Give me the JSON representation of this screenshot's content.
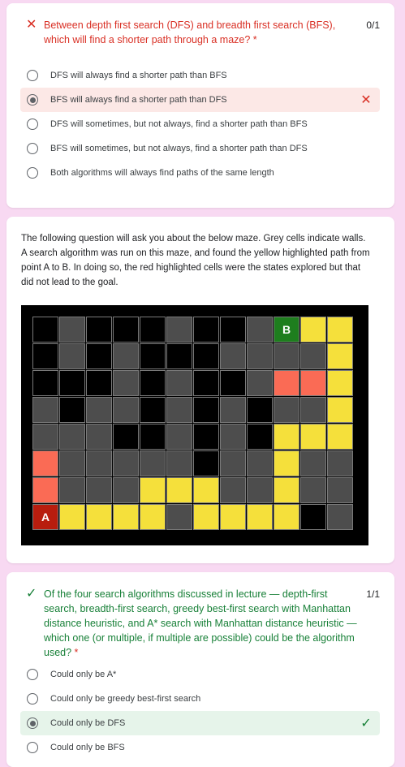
{
  "q1": {
    "mark": "✕",
    "text": "Between depth first search (DFS) and breadth first search (BFS), which will find a shorter path through a maze?",
    "required": " *",
    "score": "0/1",
    "options": [
      {
        "label": "DFS will always find a shorter path than BFS"
      },
      {
        "label": "BFS will always find a shorter path than DFS",
        "icon": "✕"
      },
      {
        "label": "DFS will sometimes, but not always, find a shorter path than BFS"
      },
      {
        "label": "BFS will sometimes, but not always, find a shorter path than DFS"
      },
      {
        "label": "Both algorithms will always find paths of the same length"
      }
    ],
    "selected_index": 1,
    "selected_icon_name": "x-mark-icon"
  },
  "maze_section": {
    "description": "The following question will ask you about the below maze. Grey cells indicate walls. A search algorithm was run on this maze, and found the yellow highlighted path from point A to B. In doing so, the red highlighted cells were the states explored but that did not lead to the goal.",
    "colors": {
      "K": "#000000",
      "G": "#4d4d4d",
      "Y": "#f5e03b",
      "R": "#fa6b55",
      "A": "#b81d0e",
      "B": "#1e7e1e"
    },
    "grid": [
      [
        "K",
        "G",
        "K",
        "K",
        "K",
        "G",
        "K",
        "K",
        "G",
        "B",
        "Y",
        "Y"
      ],
      [
        "K",
        "G",
        "K",
        "G",
        "K",
        "K",
        "K",
        "G",
        "G",
        "G",
        "G",
        "Y"
      ],
      [
        "K",
        "K",
        "K",
        "G",
        "K",
        "G",
        "K",
        "K",
        "G",
        "R",
        "R",
        "Y"
      ],
      [
        "G",
        "K",
        "G",
        "G",
        "K",
        "G",
        "K",
        "G",
        "K",
        "G",
        "G",
        "Y"
      ],
      [
        "G",
        "G",
        "G",
        "K",
        "K",
        "G",
        "K",
        "G",
        "K",
        "Y",
        "Y",
        "Y"
      ],
      [
        "R",
        "G",
        "G",
        "G",
        "G",
        "G",
        "K",
        "G",
        "G",
        "Y",
        "G",
        "G"
      ],
      [
        "R",
        "G",
        "G",
        "G",
        "Y",
        "Y",
        "Y",
        "G",
        "G",
        "Y",
        "G",
        "G"
      ],
      [
        "A",
        "Y",
        "Y",
        "Y",
        "Y",
        "G",
        "Y",
        "Y",
        "Y",
        "Y",
        "K",
        "G"
      ]
    ],
    "label_A": "A",
    "label_B": "B"
  },
  "q2": {
    "mark": "✓",
    "text": "Of the four search algorithms discussed in lecture — depth-first search, breadth-first search, greedy best-first search with Manhattan distance heuristic, and A* search with Manhattan distance heuristic — which one (or multiple, if multiple are possible) could be the algorithm used?",
    "required": " *",
    "score": "1/1",
    "options": [
      {
        "label": "Could only be A*"
      },
      {
        "label": "Could only be greedy best-first search"
      },
      {
        "label": "Could only be DFS",
        "icon": "✓"
      },
      {
        "label": "Could only be BFS"
      }
    ],
    "selected_index": 2,
    "selected_icon_name": "check-mark-icon"
  }
}
